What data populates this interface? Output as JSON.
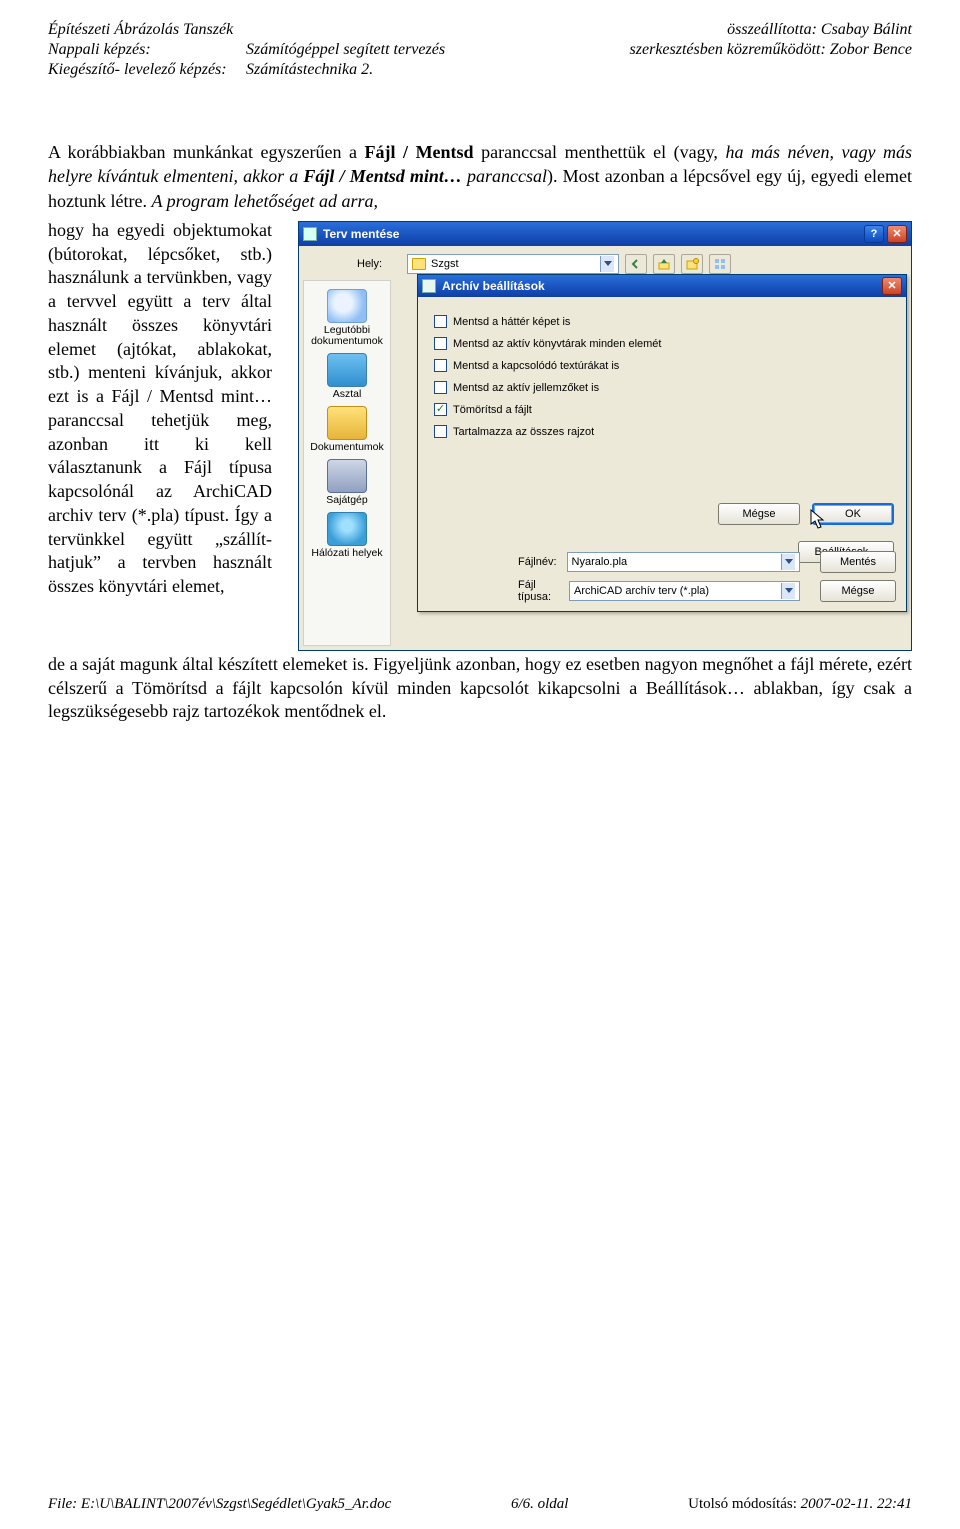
{
  "header": {
    "left": {
      "line1": "Építészeti Ábrázolás Tanszék",
      "line2_label": "Nappali képzés:",
      "line2_value": "Számítógéppel segített tervezés",
      "line3_label": "Kiegészítő- levelező képzés:",
      "line3_value": "Számítástechnika 2."
    },
    "right": {
      "line1_label": "összeállította:",
      "line1_value": "Csabay Bálint",
      "line2_label": "szerkesztésben közreműködött:",
      "line2_value": "Zobor Bence"
    }
  },
  "para": {
    "p1_a": "A korábbiakban munkánkat egyszerűen a ",
    "p1_b": "Fájl / Mentsd",
    "p1_c": " paranccsal menthettük el (vagy, ",
    "p1_d": "ha más néven, vagy más helyre kívántuk elmenteni, akkor a ",
    "p1_e": "Fájl / Mentsd mint…",
    "p1_f": " paranccsal",
    "p1_g": "). Most azonban a lépcsővel egy új, egyedi elemet hoztunk létre. ",
    "p1_h": "A program lehetőséget ad arra,",
    "col_a": "hogy ha egyedi objektu­mokat (bútorokat, lépcs­őket, stb.) használunk a tervünkben, vagy a terv­vel együtt a terv által használt összes könyvtári elemet (ajtókat, ablako­kat, stb.) menteni kíván­juk, akkor ezt is a ",
    "col_b": "Fájl / Mentsd mint…",
    "col_c": " pa­ranccsal tehetjük meg, azonban itt ki kell választanunk a ",
    "col_d": "Fájl típusa",
    "col_e": " kapcsolónál az ",
    "col_f": "ArchiCAD archiv terv (*.pla)",
    "col_g": " típust.",
    "col_h": " Így a ter­vünkkel együtt „szállít­hatjuk” a tervben használt összes könyvtári elemet,",
    "after_a": "de a saját magunk által készített elemeket is. ",
    "after_b": "Figyeljünk azonban, hogy ez esetben nagyon meg­nőhet a fájl mérete, ezért célszerű a Tömörítsd a fájlt kapcsolón kívül minden kapcsolót kikap­csolni a ",
    "after_c": "Beállítások…",
    "after_d": " ablakban, így csak a legszükségesebb rajz tartozékok mentődnek el."
  },
  "dialog": {
    "title": "Terv mentése",
    "save_in_label": "Hely:",
    "folder": "Szgst",
    "places": {
      "docs": "Legutóbbi dokumentumok",
      "desktop": "Asztal",
      "mydocs": "Dokumentumok",
      "mypc": "Sajátgép",
      "net": "Hálózati helyek"
    },
    "inner": {
      "title": "Archív beállítások",
      "opt1": "Mentsd a háttér képet is",
      "opt2": "Mentsd az aktív könyvtárak minden elemét",
      "opt3": "Mentsd a kapcsolódó textúrákat is",
      "opt4": "Mentsd az aktív jellemzőket is",
      "opt5": "Tömörítsd a fájlt",
      "opt6": "Tartalmazza az összes rajzot",
      "checked": {
        "opt1": false,
        "opt2": false,
        "opt3": false,
        "opt4": false,
        "opt5": true,
        "opt6": false
      },
      "cancel": "Mégse",
      "ok": "OK",
      "settings": "Beállítások..."
    },
    "file_label": "Fájlnév:",
    "file_value": "Nyaralo.pla",
    "type_label": "Fájl típusa:",
    "type_value": "ArchiCAD archív terv (*.pla)",
    "save_btn": "Mentés",
    "cancel_btn": "Mégse"
  },
  "footer": {
    "left_label": "File: ",
    "left_value": "E:\\U\\BALINT\\2007év\\Szgst\\Segédlet\\Gyak5_Ar.doc",
    "mid": "6/6. oldal",
    "right_label": "Utolsó módosítás: ",
    "right_value": "2007-02-11. 22:41"
  }
}
